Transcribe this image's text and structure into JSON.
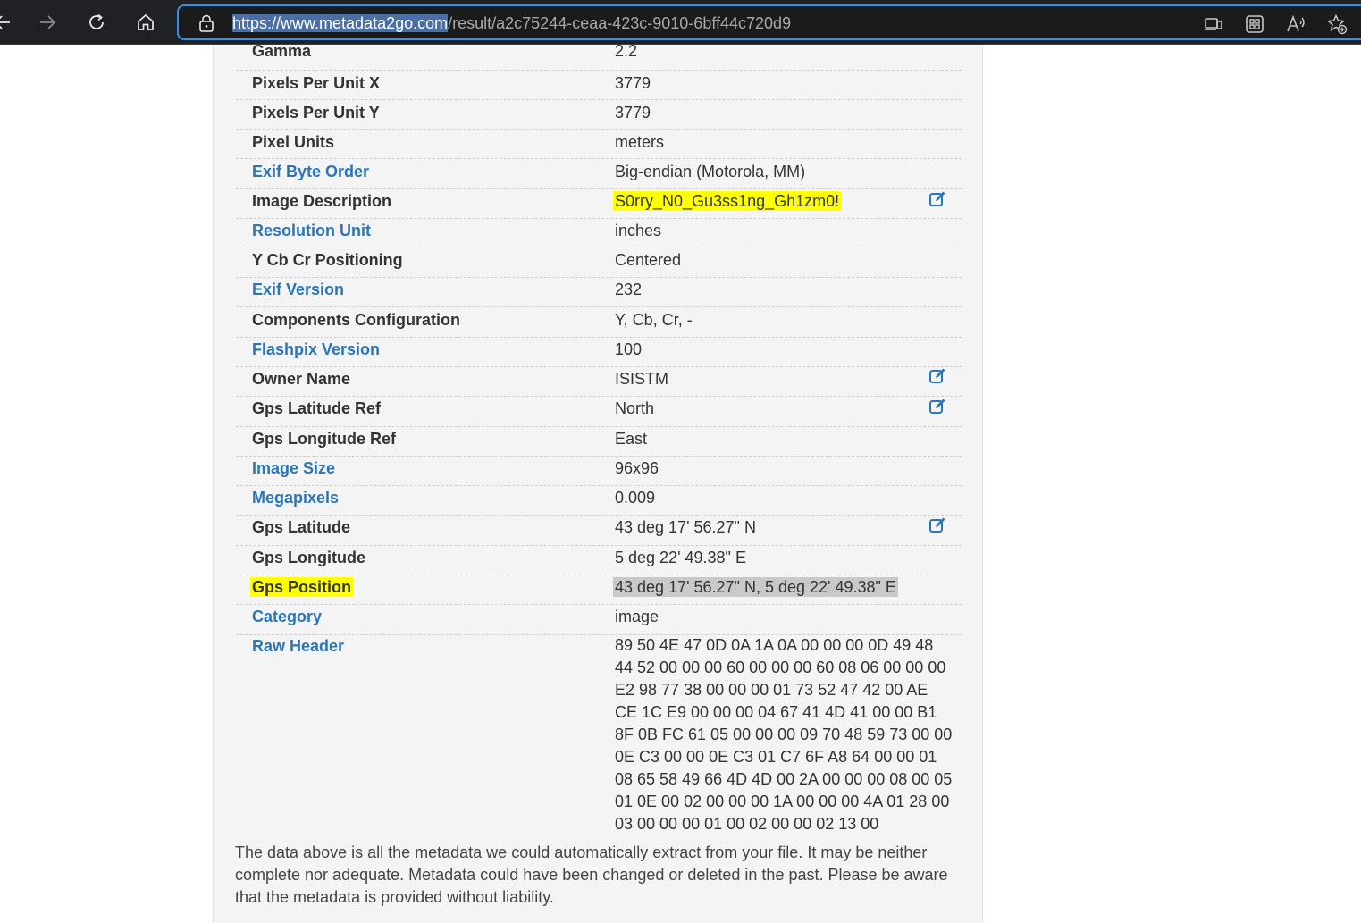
{
  "browser": {
    "url_highlighted": "https://www.metadata2go.com",
    "url_rest": "/result/a2c75244-ceaa-423c-9010-6bff44c720d9"
  },
  "rows": [
    {
      "key": "Gamma",
      "value": "2.2"
    },
    {
      "key": "Pixels Per Unit X",
      "value": "3779"
    },
    {
      "key": "Pixels Per Unit Y",
      "value": "3779"
    },
    {
      "key": "Pixel Units",
      "value": "meters"
    },
    {
      "key": "Exif Byte Order",
      "value": "Big-endian (Motorola, MM)"
    },
    {
      "key": "Image Description",
      "value": "S0rry_N0_Gu3ss1ng_Gh1zm0!"
    },
    {
      "key": "Resolution Unit",
      "value": "inches"
    },
    {
      "key": "Y Cb Cr Positioning",
      "value": "Centered"
    },
    {
      "key": "Exif Version",
      "value": "232"
    },
    {
      "key": "Components Configuration",
      "value": "Y, Cb, Cr, -"
    },
    {
      "key": "Flashpix Version",
      "value": "100"
    },
    {
      "key": "Owner Name",
      "value": "ISISTM"
    },
    {
      "key": "Gps Latitude Ref",
      "value": "North"
    },
    {
      "key": "Gps Longitude Ref",
      "value": "East"
    },
    {
      "key": "Image Size",
      "value": "96x96"
    },
    {
      "key": "Megapixels",
      "value": "0.009"
    },
    {
      "key": "Gps Latitude",
      "value": "43 deg 17' 56.27\" N"
    },
    {
      "key": "Gps Longitude",
      "value": "5 deg 22' 49.38\" E"
    },
    {
      "key": "Gps Position",
      "value": "43 deg 17' 56.27\" N, 5 deg 22' 49.38\" E"
    },
    {
      "key": "Category",
      "value": "image"
    },
    {
      "key": "Raw Header"
    }
  ],
  "raw_header_lines": [
    "89 50 4E 47 0D 0A 1A 0A 00 00 00 0D 49 48",
    "44 52 00 00 00 60 00 00 00 60 08 06 00 00 00",
    "E2 98 77 38 00 00 00 01 73 52 47 42 00 AE",
    "CE 1C E9 00 00 00 04 67 41 4D 41 00 00 B1",
    "8F 0B FC 61 05 00 00 00 09 70 48 59 73 00 00",
    "0E C3 00 00 0E C3 01 C7 6F A8 64 00 00 01",
    "08 65 58 49 66 4D 4D 00 2A 00 00 00 08 00 05",
    "01 0E 00 02 00 00 00 1A 00 00 00 4A 01 28 00",
    "03 00 00 00 01 00 02 00 00 02 13 00"
  ],
  "disclaimer": "The data above is all the metadata we could automatically extract from your file. It may be neither complete nor adequate. Metadata could have been changed or deleted in the past. Please be aware that the metadata is provided without liability.",
  "colors": {
    "link": "#2a76b9",
    "highlight": "#ffff00",
    "selection": "#c9c9c9"
  }
}
